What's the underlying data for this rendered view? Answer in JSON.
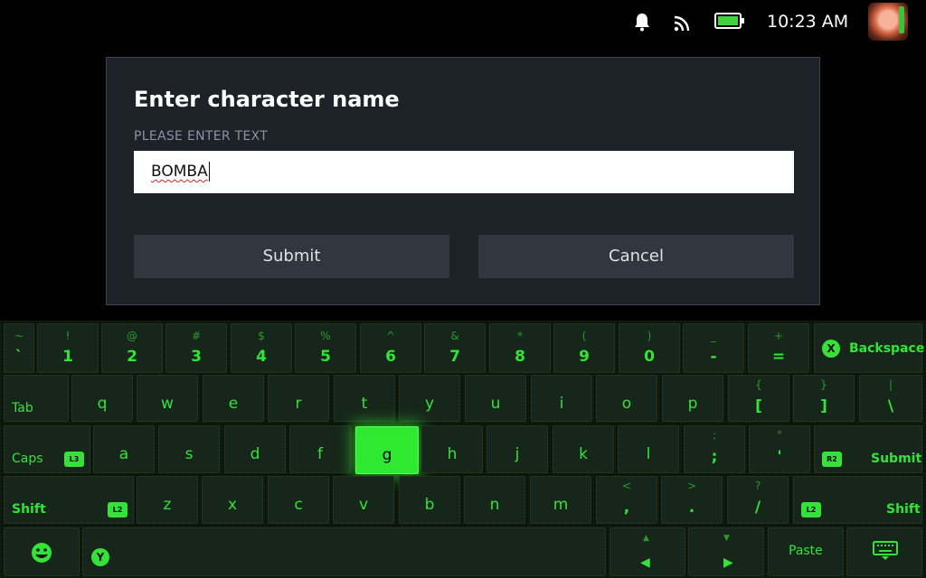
{
  "status_bar": {
    "time": "10:23 AM",
    "icons": [
      "bell-icon",
      "wifi-icon",
      "battery-icon"
    ]
  },
  "dialog": {
    "title": "Enter character name",
    "prompt": "PLEASE ENTER TEXT",
    "input_value": "BOMBA",
    "submit_label": "Submit",
    "cancel_label": "Cancel"
  },
  "keyboard": {
    "number_row": [
      {
        "shift": "~",
        "main": "`"
      },
      {
        "shift": "!",
        "main": "1"
      },
      {
        "shift": "@",
        "main": "2"
      },
      {
        "shift": "#",
        "main": "3"
      },
      {
        "shift": "$",
        "main": "4"
      },
      {
        "shift": "%",
        "main": "5"
      },
      {
        "shift": "^",
        "main": "6"
      },
      {
        "shift": "&",
        "main": "7"
      },
      {
        "shift": "*",
        "main": "8"
      },
      {
        "shift": "(",
        "main": "9"
      },
      {
        "shift": ")",
        "main": "0"
      },
      {
        "shift": "_",
        "main": "-"
      },
      {
        "shift": "+",
        "main": "="
      }
    ],
    "backspace": {
      "label": "Backspace",
      "badge": "X"
    },
    "tab": "Tab",
    "row_q": [
      "q",
      "w",
      "e",
      "r",
      "t",
      "y",
      "u",
      "i",
      "o",
      "p"
    ],
    "row_q_sym": [
      {
        "shift": "{",
        "main": "["
      },
      {
        "shift": "}",
        "main": "]"
      },
      {
        "shift": "|",
        "main": "\\"
      }
    ],
    "caps": {
      "label": "Caps",
      "badge": "L3"
    },
    "row_a": [
      "a",
      "s",
      "d",
      "f",
      "g",
      "h",
      "j",
      "k",
      "l"
    ],
    "row_a_sym": [
      {
        "shift": ":",
        "main": ";"
      },
      {
        "shift": "\"",
        "main": "'"
      }
    ],
    "submit": {
      "label": "Submit",
      "badge": "R2"
    },
    "shift_left": {
      "label": "Shift",
      "badge": "L2"
    },
    "row_z": [
      "z",
      "x",
      "c",
      "v",
      "b",
      "n",
      "m"
    ],
    "row_z_sym": [
      {
        "shift": "<",
        "main": ","
      },
      {
        "shift": ">",
        "main": "."
      },
      {
        "shift": "?",
        "main": "/"
      }
    ],
    "shift_right": {
      "label": "Shift",
      "badge": "L2"
    },
    "space_badge": "Y",
    "paste": "Paste",
    "active_key": "g",
    "accent_color": "#35e23a"
  }
}
